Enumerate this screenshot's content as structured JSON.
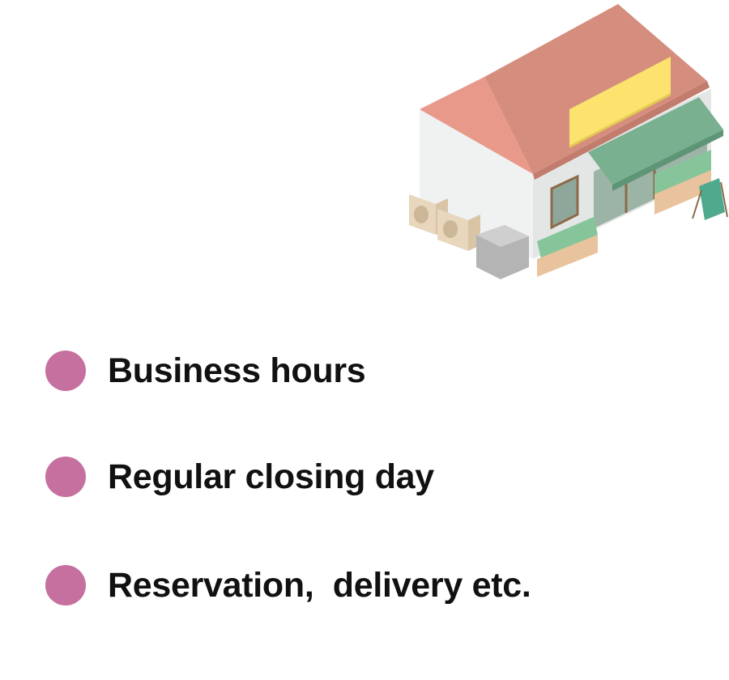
{
  "illustration": {
    "name": "shop-building",
    "colors": {
      "roof": "#d58e7e",
      "roof_front": "#e9998a",
      "wall": "#f0f1f1",
      "sign": "#fbe36e",
      "awning": "#79b08f",
      "door_window": "#8fa79a",
      "planter": "#e9c39d",
      "ac_unit": "#e8d6bd",
      "vent": "#b4b4b4"
    }
  },
  "bullet_color": "#c6709f",
  "items": [
    {
      "label": "Business hours"
    },
    {
      "label": "Regular closing day"
    },
    {
      "label": "Reservation,  delivery etc."
    }
  ]
}
